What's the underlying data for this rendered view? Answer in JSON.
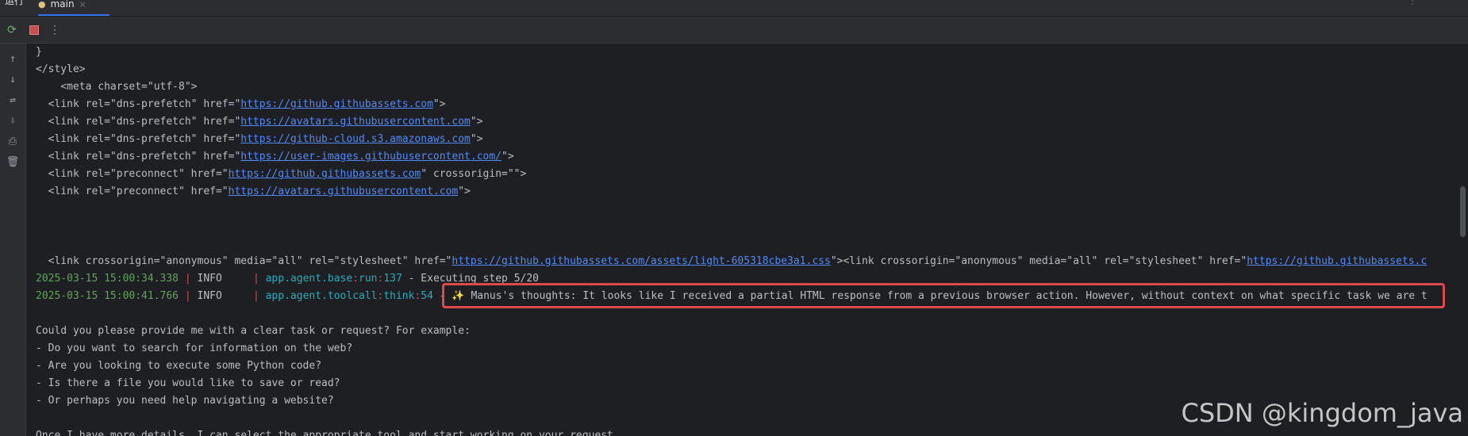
{
  "header": {
    "run_label": "运行",
    "tab_label": "main",
    "tab_close": "×",
    "more": "⋮"
  },
  "toolbar": {
    "rerun_icon": "⟳",
    "more": "⋮"
  },
  "sidebar": {
    "icons": [
      "↑",
      "↓",
      "⇌",
      "⇩",
      "⎙",
      "🗑"
    ]
  },
  "console": {
    "lines": [
      {
        "kind": "plain",
        "text": "}"
      },
      {
        "kind": "plain",
        "text": "</style>"
      },
      {
        "kind": "plain",
        "text": "    <meta charset=\"utf-8\">"
      },
      {
        "kind": "link",
        "before": "  <link rel=\"dns-prefetch\" href=\"",
        "url": "https://github.githubassets.com",
        "after": "\">"
      },
      {
        "kind": "link",
        "before": "  <link rel=\"dns-prefetch\" href=\"",
        "url": "https://avatars.githubusercontent.com",
        "after": "\">"
      },
      {
        "kind": "link",
        "before": "  <link rel=\"dns-prefetch\" href=\"",
        "url": "https://github-cloud.s3.amazonaws.com",
        "after": "\">"
      },
      {
        "kind": "link",
        "before": "  <link rel=\"dns-prefetch\" href=\"",
        "url": "https://user-images.githubusercontent.com/",
        "after": "\">"
      },
      {
        "kind": "link",
        "before": "  <link rel=\"preconnect\" href=\"",
        "url": "https://github.githubassets.com",
        "after": "\" crossorigin=\"\">"
      },
      {
        "kind": "link",
        "before": "  <link rel=\"preconnect\" href=\"",
        "url": "https://avatars.githubusercontent.com",
        "after": "\">"
      },
      {
        "kind": "plain",
        "text": ""
      },
      {
        "kind": "plain",
        "text": ""
      },
      {
        "kind": "plain",
        "text": ""
      },
      {
        "kind": "link2",
        "before": "  <link crossorigin=\"anonymous\" media=\"all\" rel=\"stylesheet\" href=\"",
        "url": "https://github.githubassets.com/assets/light-605318cbe3a1.css",
        "middle": "\"><link crossorigin=\"anonymous\" media=\"all\" rel=\"stylesheet\" href=\"",
        "url2": "https://github.githubassets.c"
      },
      {
        "kind": "log",
        "ts": "2025-03-15 15:00:34.338",
        "level": "INFO    ",
        "module": "app.agent.base",
        "func": "run",
        "lineno": "137",
        "msg": " - Executing step 5/20"
      },
      {
        "kind": "log",
        "ts": "2025-03-15 15:00:41.766",
        "level": "INFO    ",
        "module": "app.agent.toolcall",
        "func": "think",
        "lineno": "54",
        "msg": " - ✨ Manus's thoughts: It looks like I received a partial HTML response from a previous browser action. However, without context on what specific task we are t"
      },
      {
        "kind": "plain",
        "text": ""
      },
      {
        "kind": "plain",
        "text": "Could you please provide me with a clear task or request? For example:"
      },
      {
        "kind": "plain",
        "text": "- Do you want to search for information on the web?"
      },
      {
        "kind": "plain",
        "text": "- Are you looking to execute some Python code?"
      },
      {
        "kind": "plain",
        "text": "- Is there a file you would like to save or read?"
      },
      {
        "kind": "plain",
        "text": "- Or perhaps you need help navigating a website?"
      },
      {
        "kind": "plain",
        "text": ""
      },
      {
        "kind": "plain",
        "text": "Once I have more details, I can select the appropriate tool and start working on your request."
      }
    ]
  },
  "watermark": "CSDN @kingdom_java",
  "colors": {
    "accent": "#3574f0",
    "url": "#548af7",
    "timestamp": "#62a35c",
    "highlight": "#e04949"
  }
}
